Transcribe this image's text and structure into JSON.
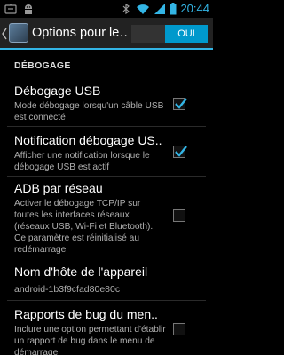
{
  "status_bar": {
    "time": "20:44"
  },
  "action_bar": {
    "title": "Options pour le…",
    "switch_label": "OUI"
  },
  "section": {
    "header": "DÉBOGAGE"
  },
  "prefs": [
    {
      "title": "Débogage USB",
      "summary": "Mode débogage lorsqu'un câble USB est connecté",
      "checked": true
    },
    {
      "title": "Notification débogage US..",
      "summary": "Afficher une notification lorsque le débogage USB est actif",
      "checked": true
    },
    {
      "title": "ADB par réseau",
      "summary": "Activer le débogage TCP/IP sur toutes les interfaces réseaux (réseaux USB, Wi-Fi et Bluetooth). Ce paramètre est réinitialisé au redémarrage",
      "checked": false
    },
    {
      "title": "Nom d'hôte de l'appareil",
      "summary": "android-1b3f9cfad80e80c"
    },
    {
      "title": "Rapports de bug du men..",
      "summary": "Inclure une option permettant d'établir un rapport de bug dans le menu de démarrage",
      "checked": false
    }
  ],
  "colors": {
    "accent": "#33b5e5",
    "switch_on": "#0099cc"
  }
}
